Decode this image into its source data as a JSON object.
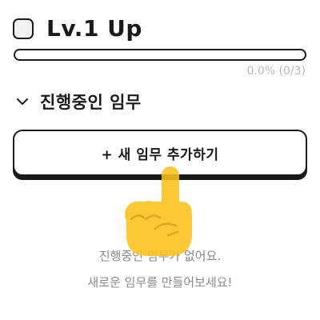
{
  "header": {
    "level_title": "Lv.1 Up"
  },
  "progress": {
    "value_fraction": 0.0,
    "text": "0.0% (0/3)"
  },
  "section": {
    "title": "진행중인 임무",
    "chevron_icon": "chevron-down-icon"
  },
  "add_button": {
    "label": "+ 새 임무 추가하기"
  },
  "hand_icon": "pointing-hand-icon",
  "empty_state": {
    "line1": "진행중인 임무가 없어요.",
    "line2": "새로운 임무를 만들어보세요!"
  },
  "colors": {
    "text": "#1a1a1a",
    "muted": "#8a8a8a",
    "progress_text": "#b9b9b9",
    "hand": "#fcc21b"
  }
}
